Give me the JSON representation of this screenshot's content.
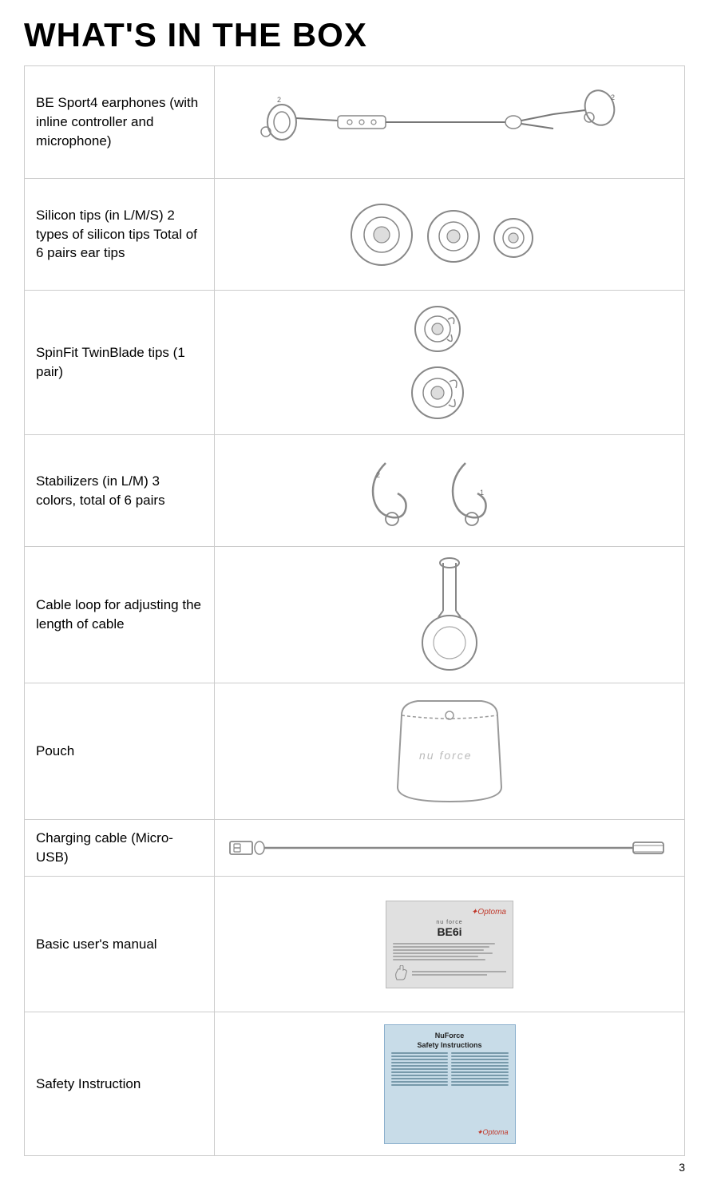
{
  "title": "WHAT'S IN THE BOX",
  "page_number": "3",
  "rows": [
    {
      "id": "earphones",
      "label": "BE Sport4 earphones (with inline controller and microphone)",
      "image_type": "earphones"
    },
    {
      "id": "silicon-tips",
      "label": "Silicon tips (in L/M/S) 2 types of silicon tips Total of 6 pairs ear tips",
      "image_type": "silicon-tips"
    },
    {
      "id": "spinfit",
      "label": "SpinFit TwinBlade tips (1 pair)",
      "image_type": "spinfit"
    },
    {
      "id": "stabilizers",
      "label": "Stabilizers (in L/M) 3 colors, total of 6 pairs",
      "image_type": "stabilizers"
    },
    {
      "id": "cable-loop",
      "label": "Cable loop for adjusting the length of cable",
      "image_type": "cable-loop"
    },
    {
      "id": "pouch",
      "label": "Pouch",
      "image_type": "pouch"
    },
    {
      "id": "charging-cable",
      "label": "Charging cable (Micro-USB)",
      "image_type": "charging-cable"
    },
    {
      "id": "manual",
      "label": "Basic user's manual",
      "image_type": "manual"
    },
    {
      "id": "safety",
      "label": "Safety Instruction",
      "image_type": "safety"
    }
  ]
}
